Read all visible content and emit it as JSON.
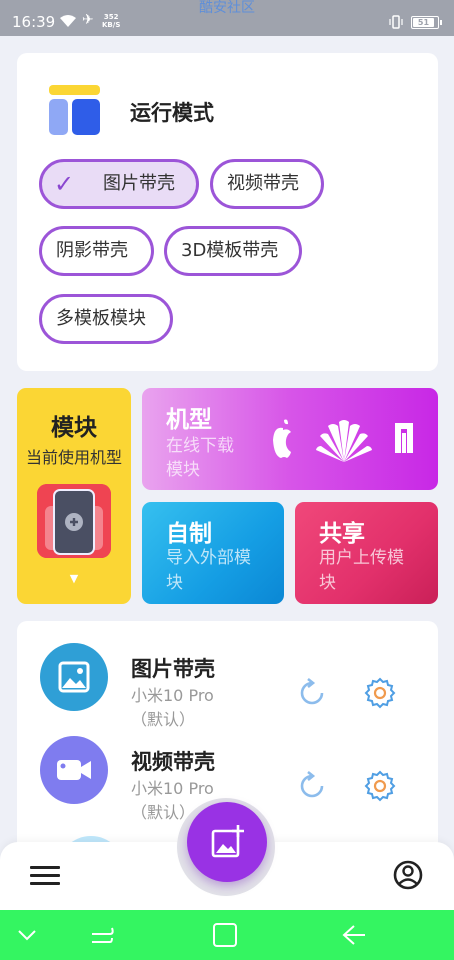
{
  "status_bar": {
    "time": "16:39",
    "speed_value": "352",
    "speed_unit": "KB/S",
    "center_title": "酷安社区",
    "battery": "51",
    "icons": [
      "wifi-icon",
      "airplane-icon",
      "vibrate-icon",
      "battery-icon"
    ]
  },
  "mode": {
    "title": "运行模式",
    "options": [
      {
        "label": "图片带壳",
        "selected": true
      },
      {
        "label": "视频带壳",
        "selected": false
      },
      {
        "label": "阴影带壳",
        "selected": false
      },
      {
        "label": "3D模板带壳",
        "selected": false
      },
      {
        "label": "多模板模块",
        "selected": false
      }
    ]
  },
  "tiles": {
    "module": {
      "title": "模块",
      "subtitle": "当前使用机型"
    },
    "model": {
      "title": "机型",
      "subtitle": "在线下载模块",
      "brands": [
        "apple-icon",
        "huawei-icon",
        "xiaomi-icon"
      ]
    },
    "custom": {
      "title": "自制",
      "subtitle": "导入外部模块"
    },
    "share": {
      "title": "共享",
      "subtitle": "用户上传模块"
    }
  },
  "modules": [
    {
      "name": "图片带壳",
      "device": "小米10 Pro",
      "tag": "（默认）",
      "icon": "image-icon",
      "color": "#2f9fd6"
    },
    {
      "name": "视频带壳",
      "device": "小米10 Pro",
      "tag": "（默认）",
      "icon": "video-icon",
      "color": "#7f7cef"
    }
  ],
  "colors": {
    "accent": "#9c55d8",
    "fab": "#9932e4",
    "module_tile": "#fbd634",
    "nav_bar": "#34f561",
    "action_icons": "#4f9ee3"
  }
}
